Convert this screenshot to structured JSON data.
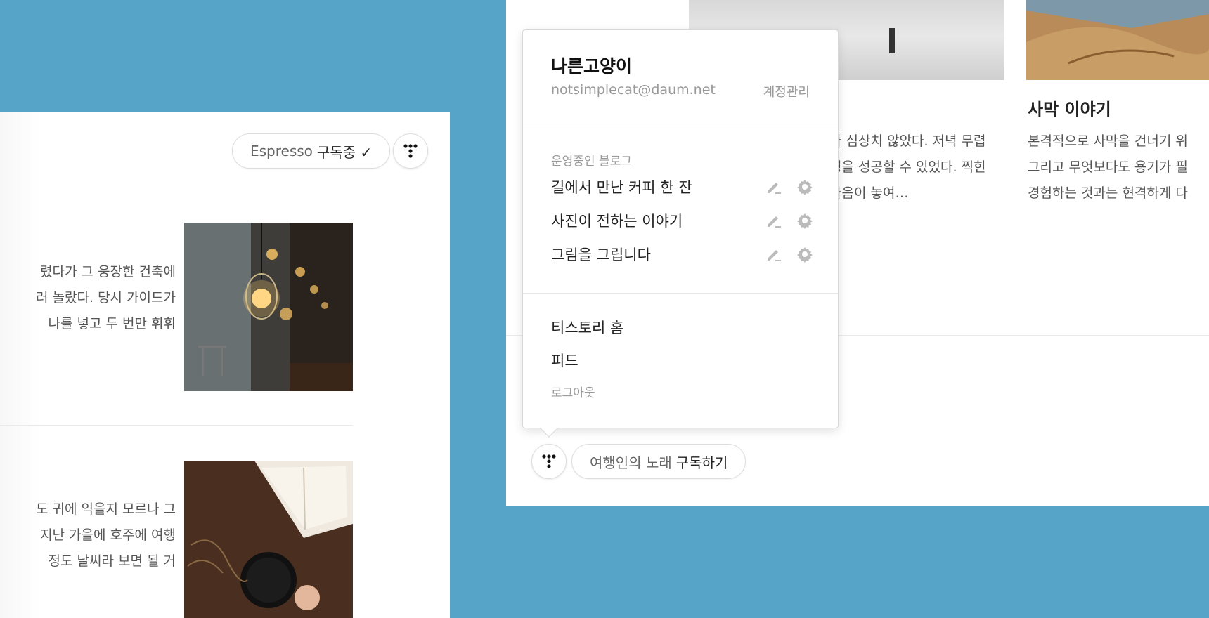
{
  "left_card": {
    "subscription": {
      "blog_name": "Espresso",
      "status": "구독중 ✓"
    },
    "excerpt_1": [
      "렸다가 그 웅장한 건축에",
      "러 놀랐다. 당시 가이드가",
      "나를 넣고 두 번만 휘휘"
    ],
    "excerpt_2": [
      "도 귀에 익을지 모르나 그",
      "지난 가을에 호주에 여행",
      "정도 날씨라 보면 될 거"
    ]
  },
  "right_card": {
    "post_title": "사막 이야기",
    "excerpt_a": [
      "나 심상치 않았다. 저녁 무렵",
      "령을 성공할 수 있었다. 찍힌",
      "다음이 놓여…"
    ],
    "excerpt_b": [
      "본격적으로 사막을 건너기 위",
      "그리고 무엇보다도 용기가 필",
      "경험하는 것과는 현격하게 다"
    ],
    "subscription": {
      "blog_name": "여행인의 노래",
      "action": "구독하기"
    }
  },
  "menu": {
    "user_name": "나른고양이",
    "email": "notsimplecat@daum.net",
    "account_link": "계정관리",
    "blogs_label": "운영중인 블로그",
    "blogs": [
      {
        "name": "길에서 만난 커피 한 잔"
      },
      {
        "name": "사진이 전하는 이야기"
      },
      {
        "name": "그림을 그립니다"
      }
    ],
    "links": {
      "home": "티스토리 홈",
      "feed": "피드",
      "logout": "로그아웃"
    }
  },
  "colors": {
    "background": "#56a4c8",
    "muted_text": "#999999",
    "icon_gray": "#bbbbbb"
  },
  "icons": [
    "tistory-logo-icon",
    "pencil-icon",
    "gear-icon",
    "check-icon"
  ]
}
